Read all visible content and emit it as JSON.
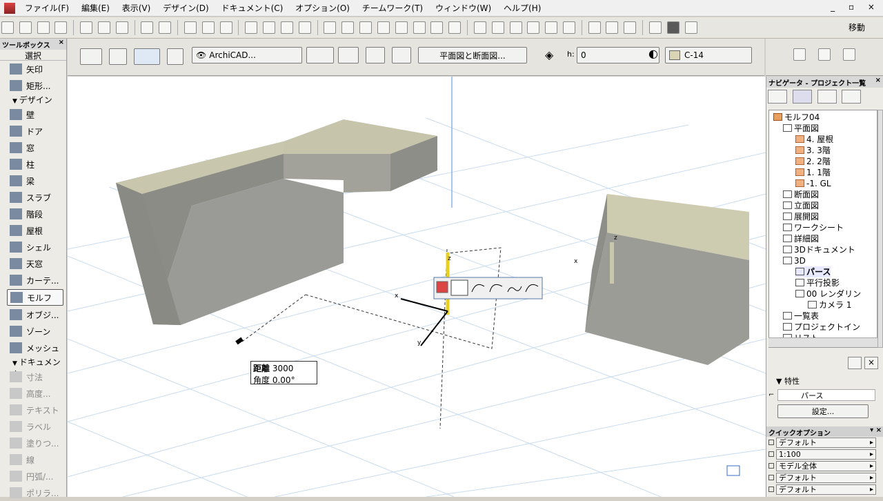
{
  "menubar": {
    "items": [
      "ファイル(F)",
      "編集(E)",
      "表示(V)",
      "デザイン(D)",
      "ドキュメント(C)",
      "オプション(O)",
      "チームワーク(T)",
      "ウィンドウ(W)",
      "ヘルプ(H)"
    ],
    "window_controls": "_ ▫ ×"
  },
  "toolbar": {
    "move_label": "移動"
  },
  "toolbox": {
    "title": "ツールボックス",
    "select_label": "選択",
    "selection_tools": [
      {
        "label": "矢印",
        "icon": "arrow-icon"
      },
      {
        "label": "矩形...",
        "icon": "marquee-icon"
      }
    ],
    "design_section": "デザイン",
    "design_tools": [
      {
        "label": "壁",
        "icon": "wall-icon"
      },
      {
        "label": "ドア",
        "icon": "door-icon"
      },
      {
        "label": "窓",
        "icon": "window-icon"
      },
      {
        "label": "柱",
        "icon": "column-icon"
      },
      {
        "label": "梁",
        "icon": "beam-icon"
      },
      {
        "label": "スラブ",
        "icon": "slab-icon"
      },
      {
        "label": "階段",
        "icon": "stair-icon"
      },
      {
        "label": "屋根",
        "icon": "roof-icon"
      },
      {
        "label": "シェル",
        "icon": "shell-icon"
      },
      {
        "label": "天窓",
        "icon": "skylight-icon"
      },
      {
        "label": "カーテ...",
        "icon": "curtain-wall-icon"
      },
      {
        "label": "モルフ",
        "icon": "morph-icon",
        "active": true
      },
      {
        "label": "オブジ...",
        "icon": "object-icon"
      },
      {
        "label": "ゾーン",
        "icon": "zone-icon"
      },
      {
        "label": "メッシュ",
        "icon": "mesh-icon"
      }
    ],
    "document_section": "ドキュメント",
    "document_tools": [
      {
        "label": "寸法",
        "icon": "dimension-icon"
      },
      {
        "label": "高度...",
        "icon": "level-dimension-icon"
      },
      {
        "label": "テキスト",
        "icon": "text-icon"
      },
      {
        "label": "ラベル",
        "icon": "label-icon"
      },
      {
        "label": "塗りつ...",
        "icon": "fill-icon"
      },
      {
        "label": "線",
        "icon": "line-icon"
      },
      {
        "label": "円弧/...",
        "icon": "arc-icon"
      },
      {
        "label": "ポリラ...",
        "icon": "polyline-icon"
      }
    ]
  },
  "infobox": {
    "layer_label": "ArchiCAD...",
    "view_button": "平面図と断面図...",
    "h_label": "h:",
    "h_value": "0",
    "material": "C-14"
  },
  "viewport": {
    "axes": {
      "x": "x",
      "y": "y",
      "z": "z"
    },
    "tracker": {
      "distance_label": "距離",
      "distance_value": "3000",
      "angle_label": "角度",
      "angle_value": "0.00°"
    }
  },
  "navigator": {
    "title": "ナビゲータ - プロジェクト一覧",
    "tree": [
      {
        "label": "モルフ04",
        "level": 0,
        "icon": "house"
      },
      {
        "label": "平面図",
        "level": 1,
        "icon": "folder"
      },
      {
        "label": "4. 屋根",
        "level": 2,
        "icon": "floor"
      },
      {
        "label": "3. 3階",
        "level": 2,
        "icon": "floor"
      },
      {
        "label": "2. 2階",
        "level": 2,
        "icon": "floor"
      },
      {
        "label": "1. 1階",
        "level": 2,
        "icon": "floor"
      },
      {
        "label": "-1. GL",
        "level": 2,
        "icon": "floor"
      },
      {
        "label": "断面図",
        "level": 1,
        "icon": "folder"
      },
      {
        "label": "立面図",
        "level": 1,
        "icon": "folder"
      },
      {
        "label": "展開図",
        "level": 1,
        "icon": "folder"
      },
      {
        "label": "ワークシート",
        "level": 1,
        "icon": "folder"
      },
      {
        "label": "詳細図",
        "level": 1,
        "icon": "folder"
      },
      {
        "label": "3Dドキュメント",
        "level": 1,
        "icon": "folder"
      },
      {
        "label": "3D",
        "level": 1,
        "icon": "folder"
      },
      {
        "label": "パース",
        "level": 2,
        "icon": "camera",
        "selected": true
      },
      {
        "label": "平行投影",
        "level": 2,
        "icon": "box"
      },
      {
        "label": "00 レンダリン",
        "level": 2,
        "icon": "camera"
      },
      {
        "label": "カメラ 1",
        "level": 3,
        "icon": "camera"
      },
      {
        "label": "一覧表",
        "level": 1,
        "icon": "folder"
      },
      {
        "label": "プロジェクトイン",
        "level": 1,
        "icon": "folder"
      },
      {
        "label": "リスト",
        "level": 1,
        "icon": "folder"
      }
    ],
    "properties_label": "特性",
    "property_name": "パース",
    "settings_button": "設定..."
  },
  "quick_options": {
    "title": "クイックオプション",
    "rows": [
      "デフォルト",
      "1:100",
      "モデル全体",
      "デフォルト",
      "デフォルト"
    ]
  }
}
